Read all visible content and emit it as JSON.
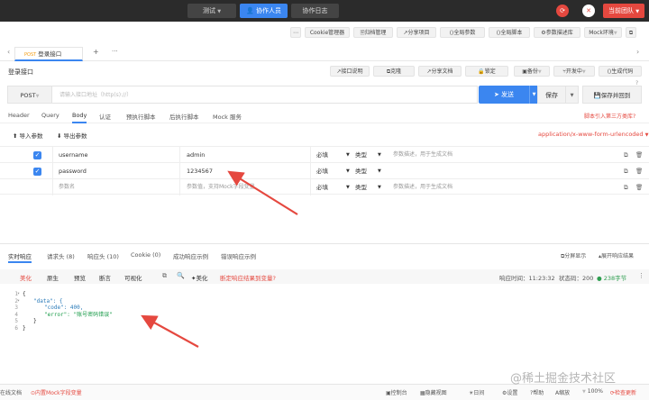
{
  "topbar": {
    "env_label": "测试",
    "collab_label": "协作人员",
    "log_label": "协作日志",
    "team_label": "当前团队"
  },
  "toolbar": {
    "items": [
      "Cookie管理器",
      "归档管理",
      "分享项目",
      "全局参数",
      "全局脚本",
      "参数描述库",
      "Mock环境"
    ]
  },
  "tabbar": {
    "active_tab_method": "POST",
    "active_tab_title": "登录接口",
    "add": "+",
    "more": "···"
  },
  "api": {
    "name": "登录接口",
    "actions": [
      "接口说明",
      "克隆",
      "分享文档",
      "锁定",
      "备份",
      "开发中",
      "生成代码"
    ],
    "method": "POST",
    "url_placeholder": "请输入接口地址（http(s)://）",
    "send_label": "发送",
    "save_label": "保存",
    "save_example_label": "保存并回到",
    "help": "?"
  },
  "req_tabs": {
    "items": [
      "Header",
      "Query",
      "Body",
      "认证",
      "预执行脚本",
      "后执行脚本",
      "Mock 服务"
    ],
    "active": "Body",
    "right_link": "脚本引入第三方类库?"
  },
  "params": {
    "import_label": "导入参数",
    "export_label": "导出参数",
    "content_type": "application/x-www-form-urlencoded",
    "rows": [
      {
        "key": "username",
        "value": "admin",
        "required": "必填",
        "type": "类型",
        "desc": "参数描述，用于生成文档"
      },
      {
        "key": "password",
        "value": "1234567",
        "required": "必填",
        "type": "类型",
        "desc": ""
      },
      {
        "key": "参数名",
        "value": "参数值，支持Mock字段变量",
        "required": "必填",
        "type": "类型",
        "desc": "参数描述，用于生成文档"
      }
    ]
  },
  "resp_tabs": {
    "items": [
      "实时响应",
      "请求头 (8)",
      "响应头 (10)",
      "Cookie (0)",
      "成功响应示例",
      "错误响应示例"
    ],
    "active": "实时响应",
    "right1": "分屏显示",
    "right2": "展开响应结果"
  },
  "resp_bar": {
    "views": [
      "美化",
      "原生",
      "预览",
      "断言",
      "可视化"
    ],
    "active_view": "美化",
    "format_label": "美化",
    "warning": "断定响应结果到变量?",
    "time_label": "响应时间：11:23:32",
    "code_label": "状态码：200",
    "size_label": "238字节"
  },
  "code": {
    "line_numbers": [
      "1",
      "2",
      "3",
      "4",
      "5",
      "6"
    ],
    "open": "{",
    "data_key": "\"data\": {",
    "code_line": "\"code\": 400,",
    "error_line": "\"error\": \"账号密码错误\"",
    "close_inner": "}",
    "close": "}"
  },
  "footer": {
    "left": "在线文档",
    "mock": "内置Mock字段变量",
    "items": [
      "控制台",
      "隐藏视图",
      "日间",
      "设置",
      "帮助",
      "缩放",
      "100%",
      "检查更新"
    ],
    "watermark": "@稀土掘金技术社区"
  },
  "colors": {
    "accent": "#3b86f0",
    "red": "#e5483f",
    "topbar": "#2b2b2b"
  }
}
